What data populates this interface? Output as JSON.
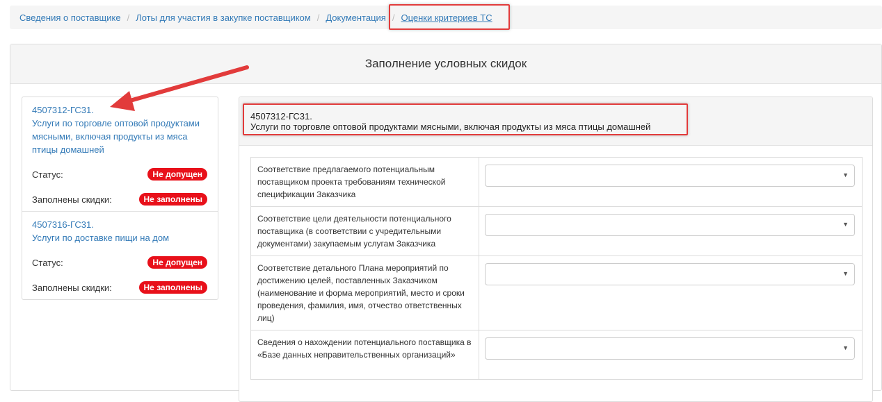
{
  "breadcrumb": {
    "items": [
      "Сведения о поставщике",
      "Лоты для участия в закупке поставщиком",
      "Документация",
      "Оценки критериев ТС"
    ],
    "separator": "/"
  },
  "main": {
    "title": "Заполнение условных скидок"
  },
  "lots": [
    {
      "code": "4507312-ГС31.",
      "name": "Услуги по торговле оптовой продуктами мясными, включая продукты из мяса птицы домашней",
      "status_label": "Статус:",
      "status_value": "Не допущен",
      "discount_label": "Заполнены скидки:",
      "discount_value": "Не заполнены"
    },
    {
      "code": "4507316-ГС31.",
      "name": "Услуги по доставке пищи на дом",
      "status_label": "Статус:",
      "status_value": "Не допущен",
      "discount_label": "Заполнены скидки:",
      "discount_value": "Не заполнены"
    }
  ],
  "detail": {
    "code": "4507312-ГС31.",
    "name": "Услуги по торговле оптовой продуктами мясными, включая продукты из мяса птицы домашней",
    "criteria": [
      {
        "label": "Соответствие предлагаемого потенциальным поставщиком проекта требованиям технической спецификации Заказчика",
        "value": ""
      },
      {
        "label": "Соответствие цели деятельности потенциального поставщика (в соответствии с учредительными документами) закупаемым услугам Заказчика",
        "value": ""
      },
      {
        "label": "Соответствие детального Плана мероприятий по достижению целей, поставленных Заказчиком (наименование и форма мероприятий, место и сроки проведения, фамилия, имя, отчество ответственных лиц)",
        "value": ""
      },
      {
        "label": "Сведения о нахождении потенциального поставщика в «Базе данных неправительственных организаций»",
        "value": ""
      }
    ]
  },
  "colors": {
    "link": "#337ab7",
    "badge": "#e8101a",
    "annotation": "#e23b3b"
  },
  "icons": {
    "select_caret": "caret-down-icon",
    "annotation_arrow": "arrow-icon"
  }
}
